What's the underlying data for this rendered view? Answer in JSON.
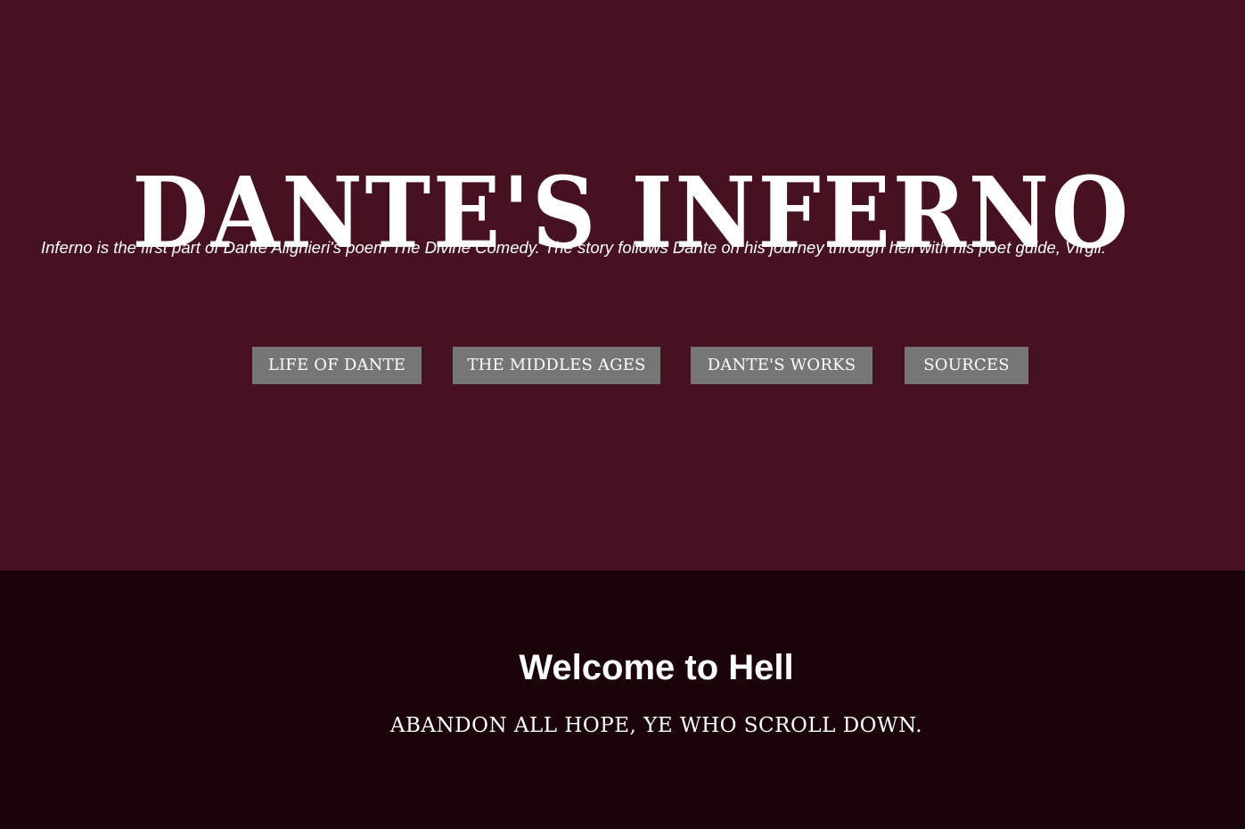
{
  "header": {
    "title": "Dante's Inferno",
    "subtitle": "Inferno is the first part of Dante Alighieri's poem The Divine Comedy. The story follows Dante on his journey through hell with his poet guide, Virgil."
  },
  "nav": {
    "items": [
      {
        "label": "Life of Dante"
      },
      {
        "label": "The Middles Ages"
      },
      {
        "label": "Dante's Works"
      },
      {
        "label": "Sources"
      }
    ]
  },
  "main": {
    "heading": "Welcome to Hell",
    "tagline": "Abandon all hope, ye who scroll down."
  },
  "colors": {
    "hero_background": "#461220",
    "section_background": "#1a0409",
    "button_background": "#767676",
    "text": "#ffffff"
  }
}
